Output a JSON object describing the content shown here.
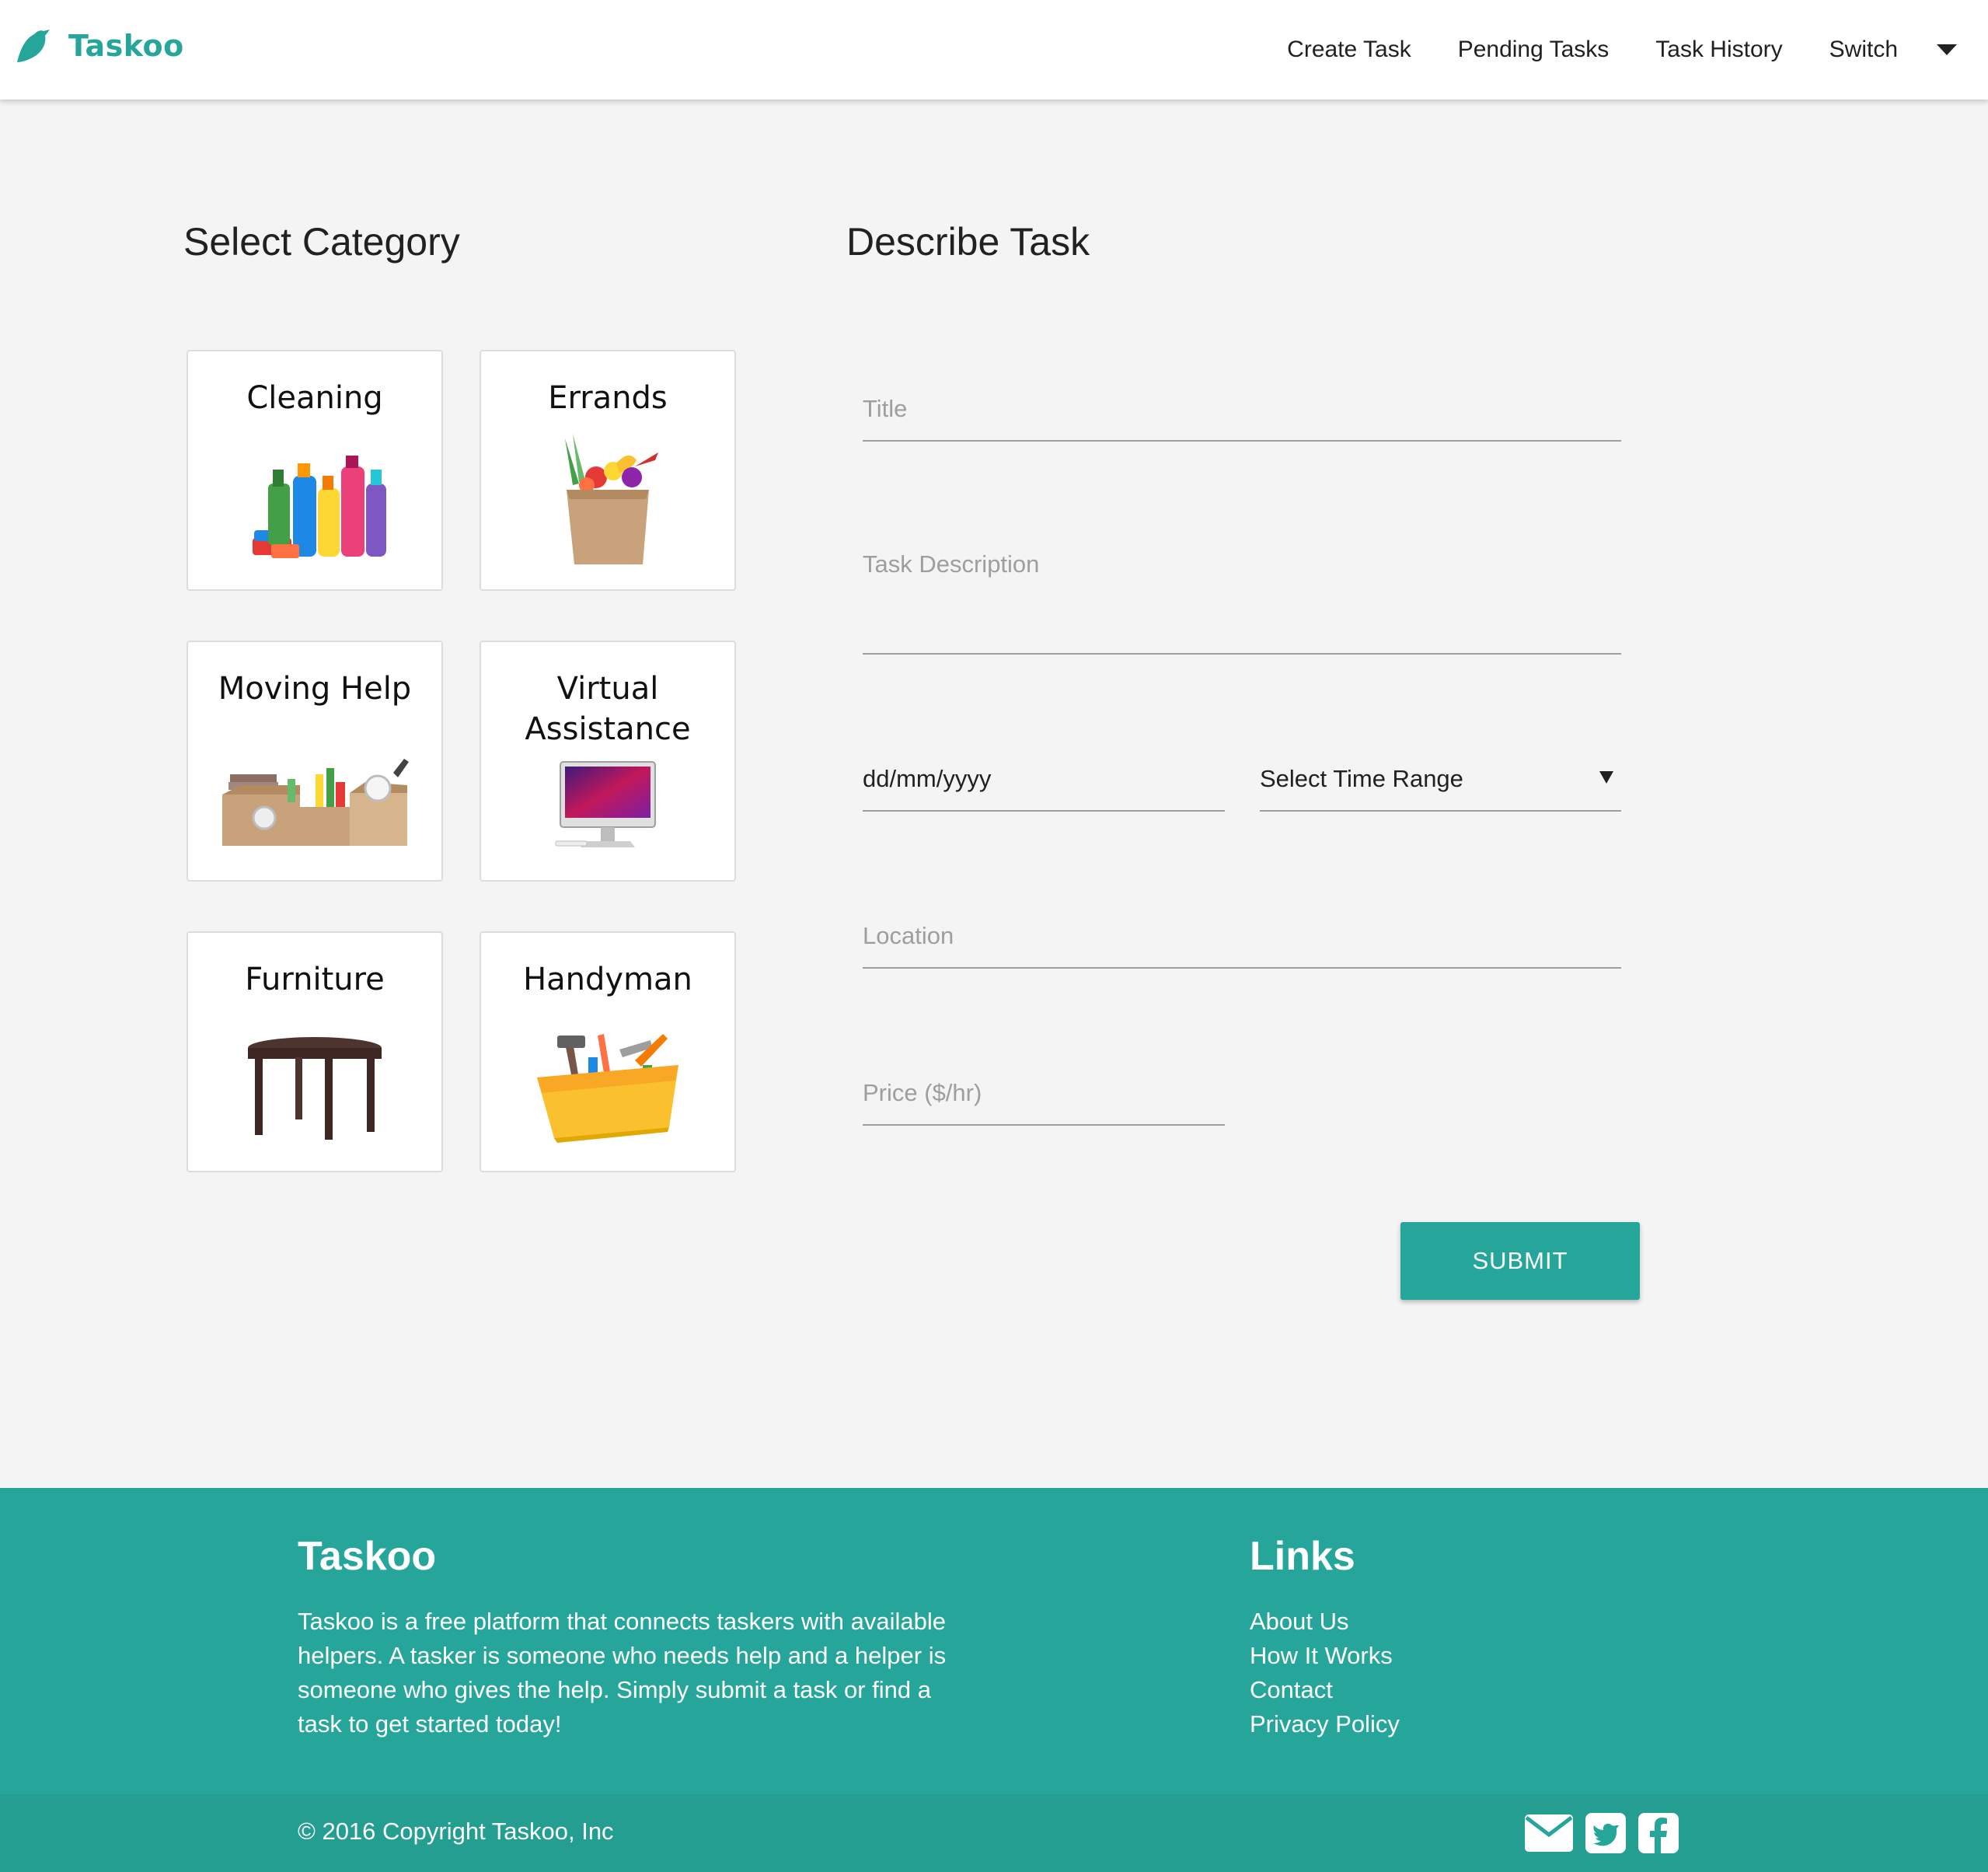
{
  "navbar": {
    "brand": "Taskoo",
    "links": [
      "Create Task",
      "Pending Tasks",
      "Task History",
      "Switch"
    ]
  },
  "categories": {
    "heading": "Select Category",
    "items": [
      {
        "label": "Cleaning",
        "icon": "cleaning-supplies-icon"
      },
      {
        "label": "Errands",
        "icon": "grocery-bag-icon"
      },
      {
        "label": "Moving Help",
        "icon": "moving-boxes-icon"
      },
      {
        "label": "Virtual Assistance",
        "icon": "computer-monitor-icon"
      },
      {
        "label": "Furniture",
        "icon": "table-icon"
      },
      {
        "label": "Handyman",
        "icon": "toolbox-icon"
      }
    ]
  },
  "form": {
    "heading": "Describe Task",
    "title_placeholder": "Title",
    "description_placeholder": "Task Description",
    "date_value": "dd/mm/yyyy",
    "time_range_value": "Select Time Range",
    "location_placeholder": "Location",
    "price_placeholder": "Price ($/hr)",
    "submit_label": "SUBMIT"
  },
  "footer": {
    "title": "Taskoo",
    "description": "Taskoo is a free platform that connects taskers with available helpers. A tasker is someone who needs help and a helper is someone who gives the help. Simply submit a task or find a task to get started today!",
    "links_title": "Links",
    "links": [
      "About Us",
      "How It Works",
      "Contact",
      "Privacy Policy"
    ],
    "copyright": "© 2016 Copyright Taskoo, Inc",
    "social_icons": [
      "envelope-icon",
      "twitter-icon",
      "facebook-icon"
    ]
  },
  "colors": {
    "brand": "#26a69a",
    "background": "#f4f4f4",
    "footer_bottom": "#249e91"
  }
}
